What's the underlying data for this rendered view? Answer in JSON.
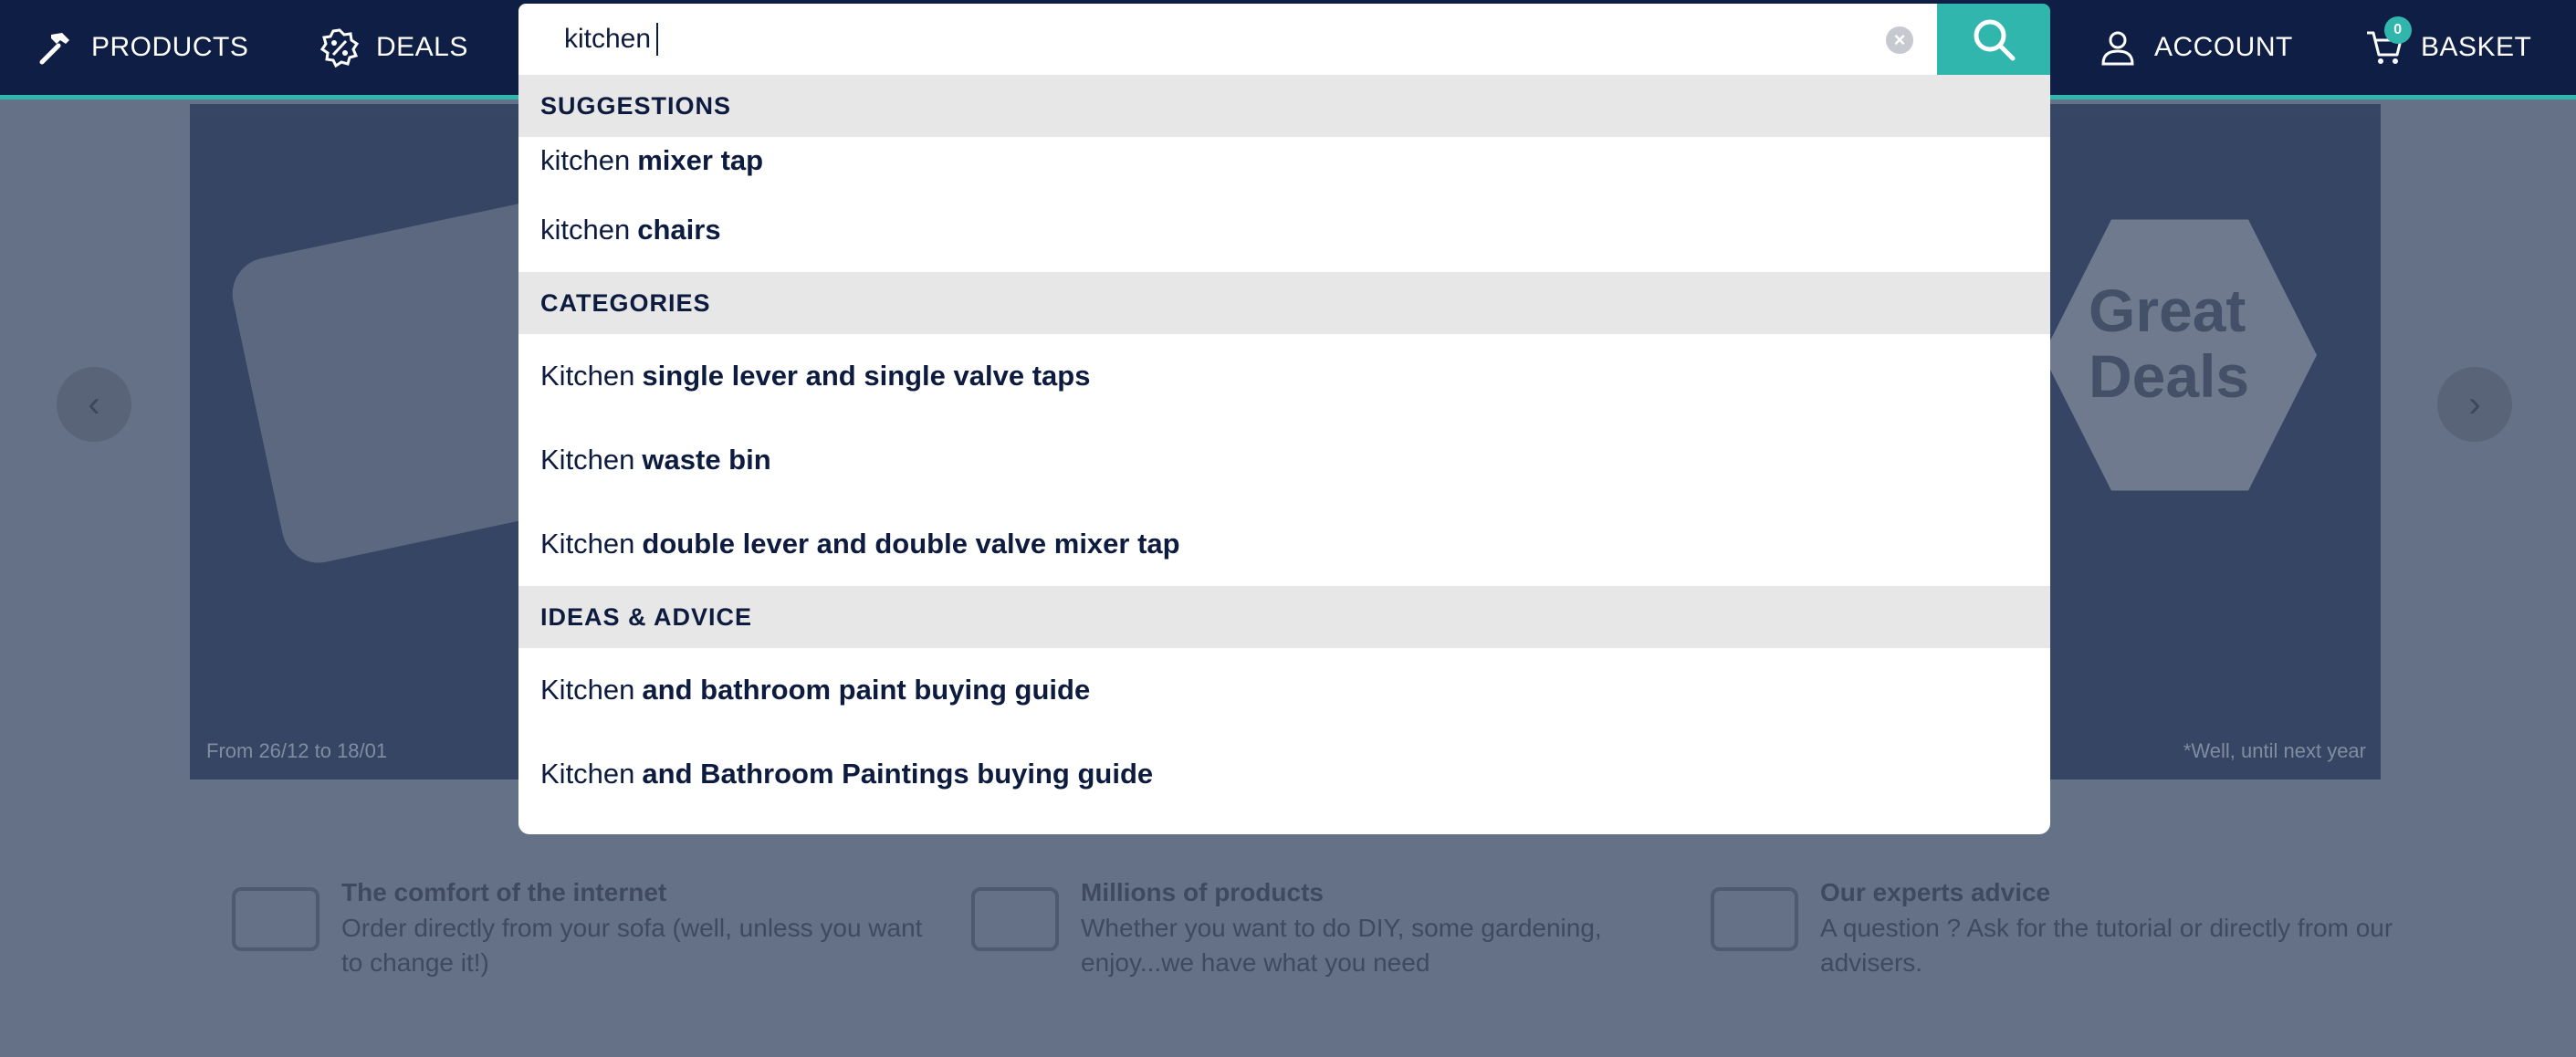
{
  "nav": {
    "products": "PRODUCTS",
    "deals": "DEALS",
    "account": "ACCOUNT",
    "basket": "BASKET",
    "basket_count": "0"
  },
  "search": {
    "value": "kitchen"
  },
  "dropdown": {
    "suggestions": {
      "heading": "SUGGESTIONS",
      "items": [
        {
          "prefix": "kitchen",
          "rest": "mixer tap"
        },
        {
          "prefix": "kitchen",
          "rest": "chairs"
        }
      ]
    },
    "categories": {
      "heading": "CATEGORIES",
      "items": [
        {
          "prefix": "Kitchen",
          "rest": "single lever and single valve taps"
        },
        {
          "prefix": "Kitchen",
          "rest": "waste bin"
        },
        {
          "prefix": "Kitchen",
          "rest": "double lever and double valve mixer tap"
        }
      ]
    },
    "ideas": {
      "heading": "IDEAS & ADVICE",
      "items": [
        {
          "prefix": "Kitchen",
          "rest": "and bathroom paint buying guide"
        },
        {
          "prefix": "Kitchen",
          "rest": "and Bathroom Paintings buying guide"
        }
      ]
    }
  },
  "hero": {
    "badge": "Great Deals",
    "dates": "From 26/12 to 18/01",
    "note": "*Well, until next year"
  },
  "features": [
    {
      "title": "The comfort of the internet",
      "text": "Order directly from your sofa (well, unless you want to change it!)"
    },
    {
      "title": "Millions of products",
      "text": "Whether you want to do DIY, some gardening, enjoy...we have what you need"
    },
    {
      "title": "Our experts advice",
      "text": "A question ? Ask for the tutorial or directly from our advisers."
    }
  ],
  "colors": {
    "navy": "#0f1e45",
    "teal": "#30b6ac",
    "overlay": "#657186",
    "section_bg": "#e7e7e7"
  },
  "icons": {
    "products": "hammer-icon",
    "deals": "badge-percent-icon",
    "account": "user-icon",
    "basket": "cart-icon",
    "search": "search-icon",
    "clear": "clear-icon"
  }
}
